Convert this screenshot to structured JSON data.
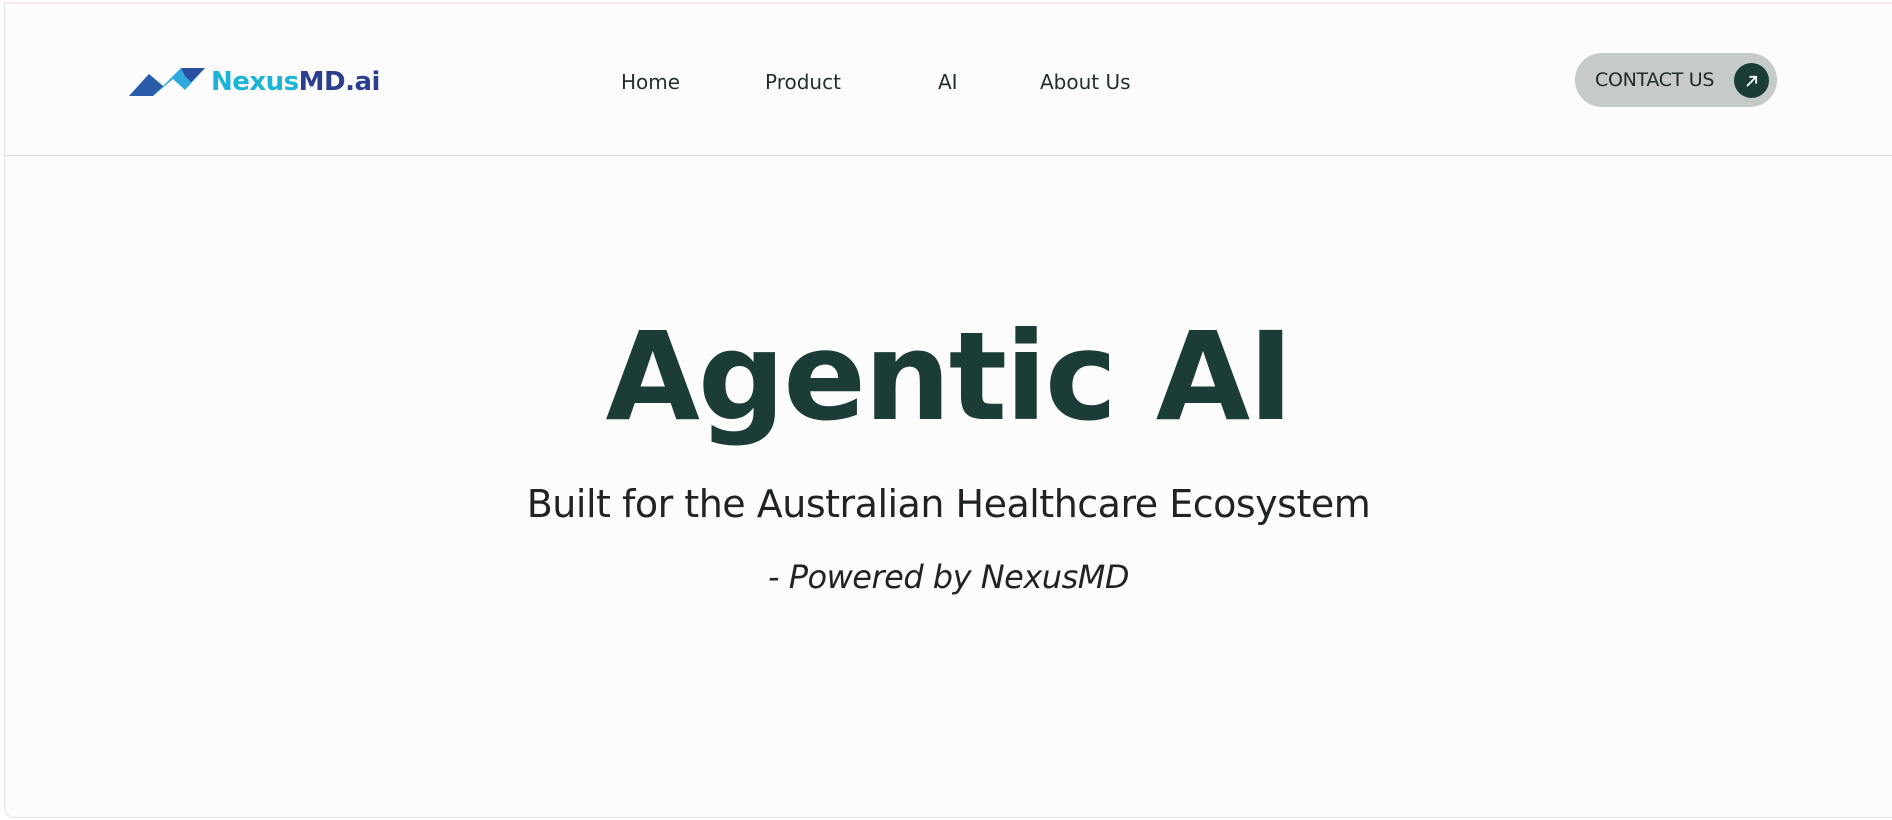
{
  "brand": {
    "name_part1": "Nexus",
    "name_part2": "MD.ai",
    "logo_icon": "nexusmd-chevron-logo-icon",
    "colors": {
      "cyan": "#1cb3d8",
      "navy": "#2b3f8e",
      "logo_mark_light": "#2ea8de",
      "logo_mark_dark": "#2a4fa0"
    }
  },
  "nav": {
    "links": [
      {
        "label": "Home"
      },
      {
        "label": "Product"
      },
      {
        "label": "AI"
      },
      {
        "label": "About Us"
      }
    ]
  },
  "contact": {
    "label": "CONTACT US",
    "icon": "arrow-up-right-icon",
    "bg_color": "#c6cbca",
    "icon_bg_color": "#1c3d37"
  },
  "hero": {
    "title": "Agentic AI",
    "subtitle": "Built for the Australian Healthcare Ecosystem",
    "tagline": "- Powered by NexusMD",
    "title_color": "#1b3c37"
  }
}
